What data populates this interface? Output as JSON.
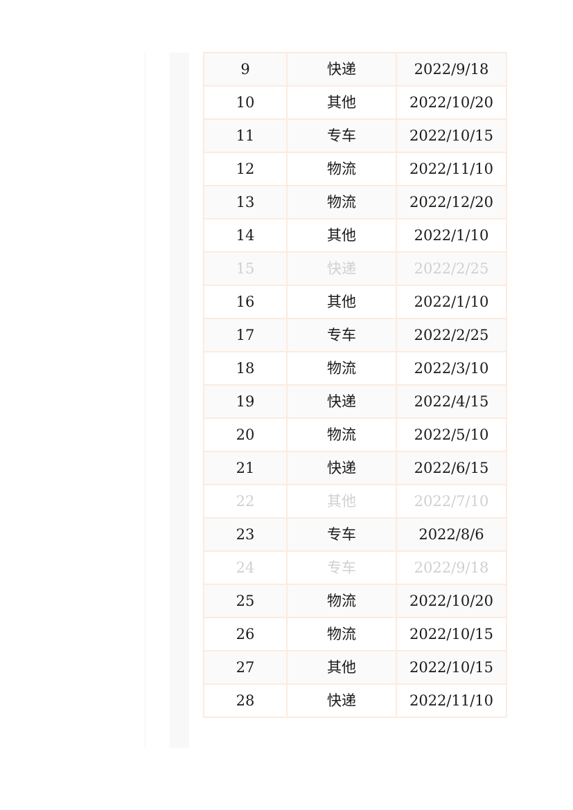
{
  "table": {
    "rows": [
      {
        "no": "9",
        "type": "快递",
        "date": "2022/9/18",
        "muted": false
      },
      {
        "no": "10",
        "type": "其他",
        "date": "2022/10/20",
        "muted": false
      },
      {
        "no": "11",
        "type": "专车",
        "date": "2022/10/15",
        "muted": false
      },
      {
        "no": "12",
        "type": "物流",
        "date": "2022/11/10",
        "muted": false
      },
      {
        "no": "13",
        "type": "物流",
        "date": "2022/12/20",
        "muted": false
      },
      {
        "no": "14",
        "type": "其他",
        "date": "2022/1/10",
        "muted": false
      },
      {
        "no": "15",
        "type": "快递",
        "date": "2022/2/25",
        "muted": true
      },
      {
        "no": "16",
        "type": "其他",
        "date": "2022/1/10",
        "muted": false
      },
      {
        "no": "17",
        "type": "专车",
        "date": "2022/2/25",
        "muted": false
      },
      {
        "no": "18",
        "type": "物流",
        "date": "2022/3/10",
        "muted": false
      },
      {
        "no": "19",
        "type": "快递",
        "date": "2022/4/15",
        "muted": false
      },
      {
        "no": "20",
        "type": "物流",
        "date": "2022/5/10",
        "muted": false
      },
      {
        "no": "21",
        "type": "快递",
        "date": "2022/6/15",
        "muted": false
      },
      {
        "no": "22",
        "type": "其他",
        "date": "2022/7/10",
        "muted": true
      },
      {
        "no": "23",
        "type": "专车",
        "date": "2022/8/6",
        "muted": false
      },
      {
        "no": "24",
        "type": "专车",
        "date": "2022/9/18",
        "muted": true
      },
      {
        "no": "25",
        "type": "物流",
        "date": "2022/10/20",
        "muted": false
      },
      {
        "no": "26",
        "type": "物流",
        "date": "2022/10/15",
        "muted": false
      },
      {
        "no": "27",
        "type": "其他",
        "date": "2022/10/15",
        "muted": false
      },
      {
        "no": "28",
        "type": "快递",
        "date": "2022/11/10",
        "muted": false
      }
    ]
  },
  "colors": {
    "border": "#fcebdf",
    "stripe": "#fafafa",
    "text": "#1a1a1a",
    "muted_text": "#d0d0d0"
  }
}
